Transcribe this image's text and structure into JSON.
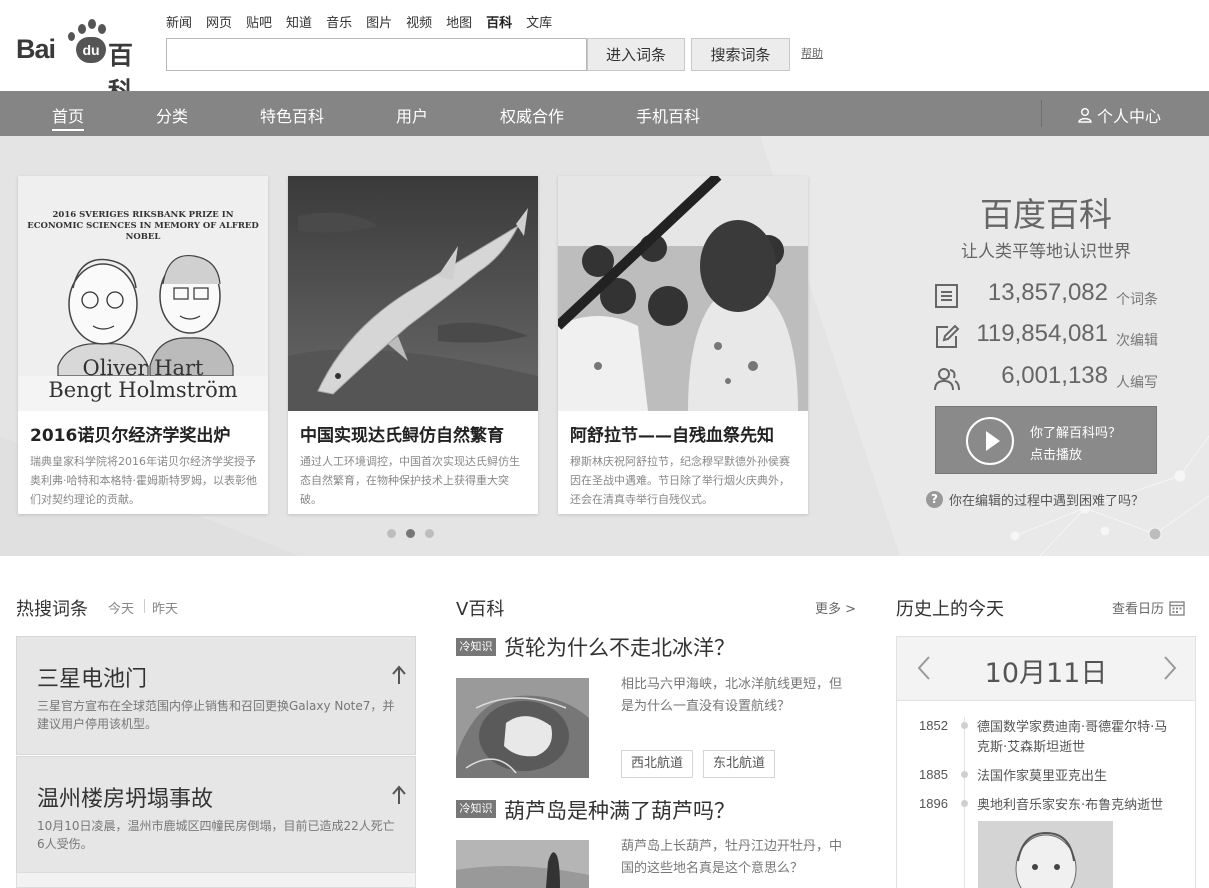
{
  "logo": {
    "text_left": "Bai",
    "text_mid": "du",
    "text_right": "百科"
  },
  "top_nav": [
    "新闻",
    "网页",
    "贴吧",
    "知道",
    "音乐",
    "图片",
    "视频",
    "地图",
    "百科",
    "文库"
  ],
  "top_nav_active": "百科",
  "search": {
    "value": "",
    "enter_label": "进入词条",
    "search_label": "搜索词条",
    "help_label": "帮助"
  },
  "main_nav": {
    "items": [
      "首页",
      "分类",
      "特色百科",
      "用户",
      "权威合作",
      "手机百科"
    ],
    "active": "首页",
    "user_center": "个人中心"
  },
  "banner": {
    "cards": [
      {
        "title": "2016诺贝尔经济学奖出炉",
        "desc": "瑞典皇家科学院将2016年诺贝尔经济学奖授予奥利弗·哈特和本格特·霍姆斯特罗姆，以表彰他们对契约理论的贡献。",
        "poster_header": "2016 SVERIGES RIKSBANK PRIZE IN ECONOMIC SCIENCES IN MEMORY OF ALFRED NOBEL",
        "poster_name1": "Oliver Hart",
        "poster_name2": "Bengt Holmström"
      },
      {
        "title": "中国实现达氏鲟仿自然繁育",
        "desc": "通过人工环境调控，中国首次实现达氏鲟仿生态自然繁育，在物种保护技术上获得重大突破。"
      },
      {
        "title": "阿舒拉节——自残血祭先知",
        "desc": "穆斯林庆祝阿舒拉节，纪念穆罕默德外孙侯赛因在圣战中遇难。节日除了举行烟火庆典外，还会在清真寺举行自残仪式。"
      }
    ],
    "slide_count": 3,
    "active_slide": 2
  },
  "brand": {
    "title": "百度百科",
    "slogan": "让人类平等地认识世界",
    "stats": [
      {
        "icon": "document-icon",
        "value": "13,857,082",
        "unit": "个词条"
      },
      {
        "icon": "edit-icon",
        "value": "119,854,081",
        "unit": "次编辑"
      },
      {
        "icon": "users-icon",
        "value": "6,001,138",
        "unit": "人编写"
      }
    ],
    "video_line1": "你了解百科吗？",
    "video_line2": "点击播放",
    "help_question": "你在编辑的过程中遇到困难了吗？"
  },
  "hot": {
    "title": "热搜词条",
    "tab_today": "今天",
    "tab_yesterday": "昨天",
    "items": [
      {
        "title": "三星电池门",
        "desc": "三星官方宣布在全球范围内停止销售和召回更换Galaxy Note7，并建议用户停用该机型。"
      },
      {
        "title": "温州楼房坍塌事故",
        "desc": "10月10日凌晨，温州市鹿城区四幢民房倒塌，目前已造成22人死亡6人受伤。"
      }
    ]
  },
  "vbaike": {
    "title": "V百科",
    "more": "更多 >",
    "items": [
      {
        "tag": "冷知识",
        "title": "货轮为什么不走北冰洋？",
        "desc": "相比马六甲海峡，北冰洋航线更短，但是为什么一直没有设置航线？",
        "keywords": [
          "西北航道",
          "东北航道"
        ]
      },
      {
        "tag": "冷知识",
        "title": "葫芦岛是种满了葫芦吗？",
        "desc": "葫芦岛上长葫芦，牡丹江边开牡丹，中国的这些地名真是这个意思么？",
        "keywords": []
      }
    ]
  },
  "history": {
    "title": "历史上的今天",
    "calendar_link": "查看日历",
    "date": "10月11日",
    "events": [
      {
        "year": "1852",
        "text": "德国数学家费迪南·哥德霍尔特·马克斯·艾森斯坦逝世"
      },
      {
        "year": "1885",
        "text": "法国作家莫里亚克出生"
      },
      {
        "year": "1896",
        "text": "奥地利音乐家安东·布鲁克纳逝世"
      }
    ]
  }
}
